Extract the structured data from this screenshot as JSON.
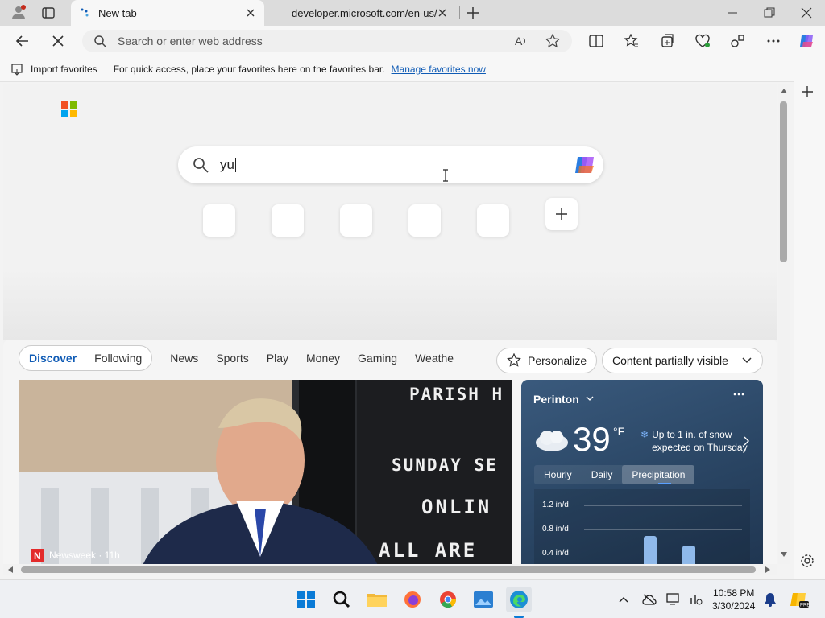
{
  "tabs": [
    {
      "label": "New tab",
      "active": true
    },
    {
      "label": "developer.microsoft.com/en-us/"
    }
  ],
  "address_bar": {
    "placeholder": "Search or enter web address"
  },
  "favorites_bar": {
    "import_label": "Import favorites",
    "hint": "For quick access, place your favorites here on the favorites bar.",
    "manage_link": "Manage favorites now"
  },
  "ntp": {
    "search_value": "yu"
  },
  "feed": {
    "tabs": [
      "Discover",
      "Following",
      "News",
      "Sports",
      "Play",
      "Money",
      "Gaming",
      "Weathe"
    ],
    "personalize_label": "Personalize",
    "content_select": "Content partially visible",
    "news_card": {
      "source": "Newsweek · 11h",
      "sign_lines": [
        "PARISH H",
        "SUNDAY SE",
        "ONLIN",
        "ALL ARE WE"
      ]
    },
    "weather": {
      "location": "Perinton",
      "temp": "39",
      "unit": "°F",
      "alert": "Up to 1 in. of snow expected on Thursday",
      "tabs": [
        "Hourly",
        "Daily",
        "Precipitation"
      ],
      "active_tab": "Precipitation",
      "chart_labels": [
        "1.2 in/d",
        "0.8 in/d",
        "0.4 in/d"
      ]
    }
  },
  "taskbar": {
    "time": "10:58 PM",
    "date": "3/30/2024"
  },
  "colors": {
    "accent": "#0f5bb5",
    "taskbar": "#eef0f3"
  }
}
